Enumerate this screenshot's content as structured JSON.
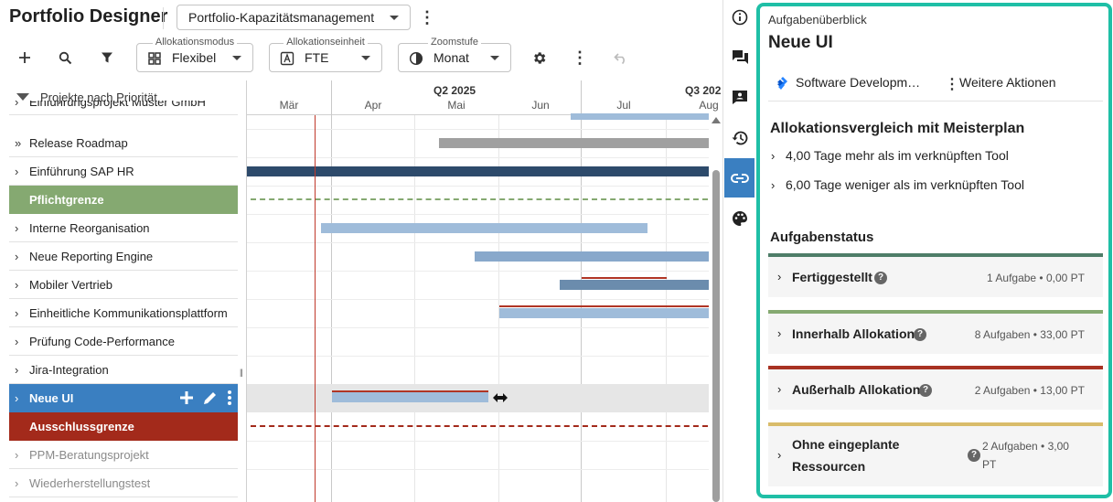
{
  "app": {
    "title": "Portfolio Designer",
    "view_select": "Portfolio-Kapazitätsmanagement"
  },
  "toolbar": {
    "mode_legend": "Allokationsmodus",
    "mode_value": "Flexibel",
    "unit_legend": "Allokationseinheit",
    "unit_value": "FTE",
    "zoom_legend": "Zoomstufe",
    "zoom_value": "Monat"
  },
  "list": {
    "header": "Projekte nach Priorität",
    "rows": [
      {
        "label": "Einführungsprojekt Muster GmbH",
        "chev": "›"
      },
      {
        "label": "Release Roadmap",
        "chev": "»"
      },
      {
        "label": "Einführung SAP HR",
        "chev": "›"
      },
      {
        "label": "Pflichtgrenze",
        "chev": ""
      },
      {
        "label": "Interne Reorganisation",
        "chev": "›"
      },
      {
        "label": "Neue Reporting Engine",
        "chev": "›"
      },
      {
        "label": "Mobiler Vertrieb",
        "chev": "›"
      },
      {
        "label": "Einheitliche Kommunikationsplattform",
        "chev": "›"
      },
      {
        "label": "Prüfung Code-Performance",
        "chev": "›"
      },
      {
        "label": "Jira-Integration",
        "chev": "›"
      },
      {
        "label": "Neue UI",
        "chev": "›"
      },
      {
        "label": "Ausschlussgrenze",
        "chev": ""
      },
      {
        "label": "PPM-Beratungsprojekt",
        "chev": "›"
      },
      {
        "label": "Wiederherstellungstest",
        "chev": "›"
      }
    ]
  },
  "timeline": {
    "quarters": [
      "Q2 2025",
      "Q3 202"
    ],
    "months": [
      "Mär",
      "Apr",
      "Mai",
      "Jun",
      "Jul",
      "Aug"
    ]
  },
  "colors": {
    "pflicht": "#85a971",
    "ausschluss": "#a32a1b",
    "selected": "#3a7fc1",
    "panel_border": "#1fbfa6"
  },
  "panel": {
    "subtitle": "Aufgabenüberblick",
    "title": "Neue UI",
    "source": "Software Developm…",
    "more_actions": "Weitere Aktionen",
    "compare_heading": "Allokationsvergleich mit Meisterplan",
    "compare_items": [
      "4,00 Tage mehr als im verknüpften Tool",
      "6,00 Tage weniger als im verknüpften Tool"
    ],
    "status_heading": "Aufgabenstatus",
    "statuses": [
      {
        "name": "Fertiggestellt",
        "count": "1 Aufgabe • 0,00 PT",
        "color": "#4e7d68"
      },
      {
        "name": "Innerhalb Allokation",
        "count": "8 Aufgaben • 33,00 PT",
        "color": "#85a971"
      },
      {
        "name": "Außerhalb Allokation",
        "count": "2 Aufgaben • 13,00 PT",
        "color": "#a83222"
      },
      {
        "name_line1": "Ohne eingeplante",
        "name_line2": "Ressourcen",
        "count_line1": "2 Aufgaben • 3,00",
        "count_line2": "PT",
        "color": "#d9bc6a"
      }
    ]
  }
}
